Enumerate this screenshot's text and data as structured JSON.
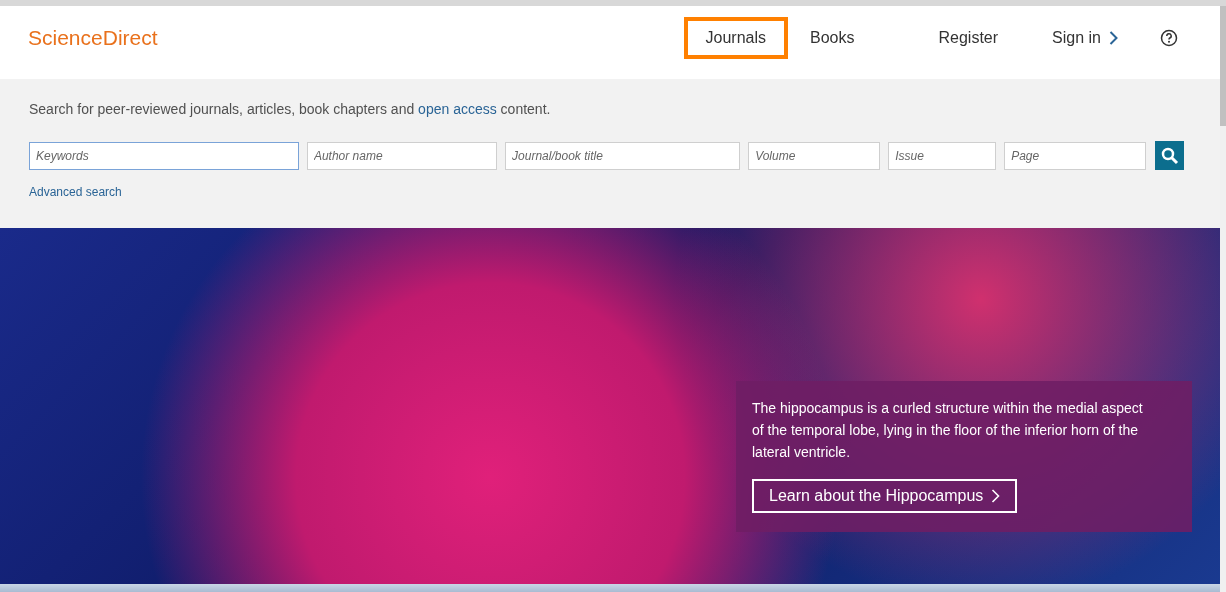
{
  "logo": "ScienceDirect",
  "nav": [
    {
      "label": "Journals",
      "highlighted": true
    },
    {
      "label": "Books",
      "highlighted": false
    },
    {
      "label": "Register",
      "highlighted": false
    },
    {
      "label": "Sign in",
      "highlighted": false
    }
  ],
  "search": {
    "intro": {
      "before": "Search for peer-reviewed journals, articles, book chapters and",
      "link": "open access",
      "after": "content."
    },
    "fields": [
      {
        "placeholder": "Keywords",
        "focused": true
      },
      {
        "placeholder": "Author name",
        "focused": false
      },
      {
        "placeholder": "Journal/book title",
        "focused": false
      },
      {
        "placeholder": "Volume",
        "focused": false
      },
      {
        "placeholder": "Issue",
        "focused": false
      },
      {
        "placeholder": "Page",
        "focused": false
      }
    ],
    "advanced_link": "Advanced search"
  },
  "hero": {
    "caption": "The hippocampus is a curled structure within the medial aspect of the temporal lobe, lying in the floor of the inferior horn of the lateral ventricle.",
    "button": "Learn about the Hippocampus"
  }
}
